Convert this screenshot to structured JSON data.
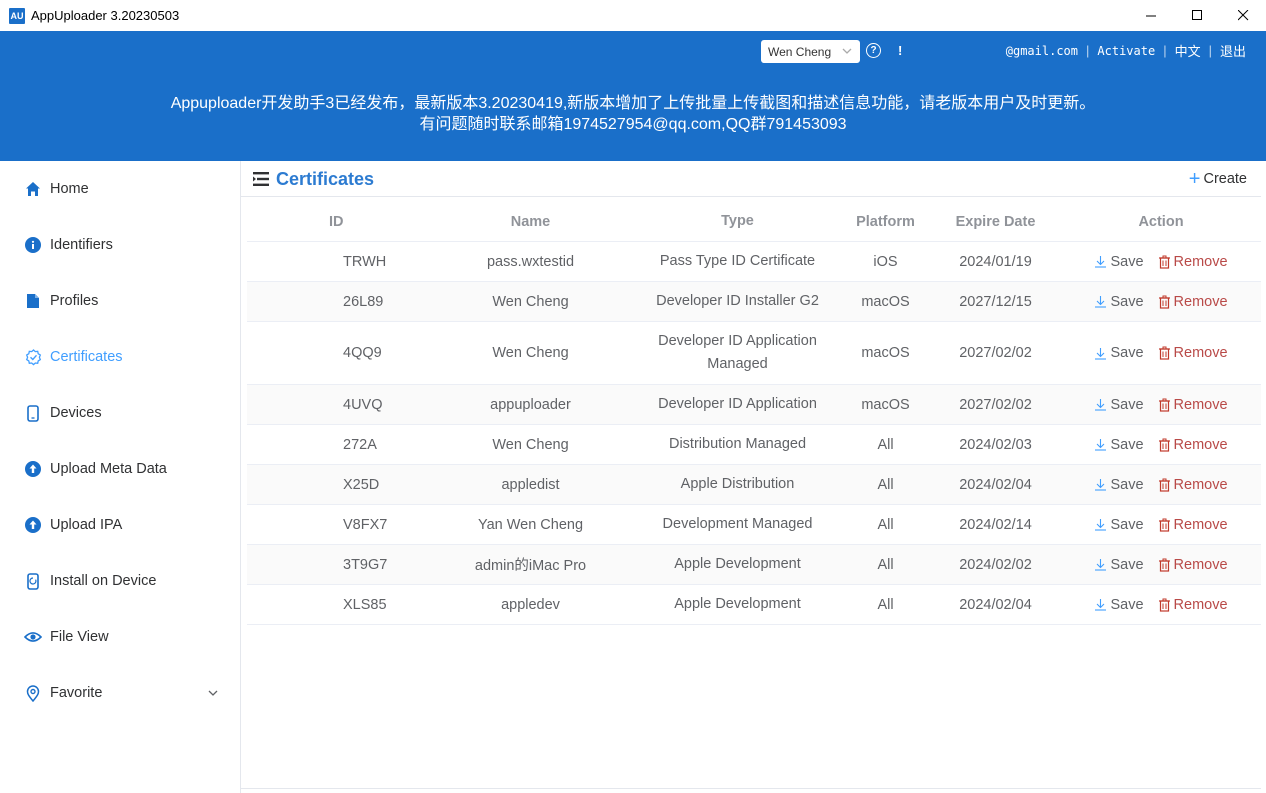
{
  "window": {
    "icon_text": "AU",
    "title": "AppUploader 3.20230503"
  },
  "header": {
    "account_selected": "Wen Cheng",
    "excl_mark": "!",
    "email": "@gmail.com",
    "activate": "Activate",
    "lang": "中文",
    "logout": "退出",
    "announcement_line1": "Appuploader开发助手3已经发布，最新版本3.20230419,新版本增加了上传批量上传截图和描述信息功能，请老版本用户及时更新。",
    "announcement_line2": "有问题随时联系邮箱1974527954@qq.com,QQ群791453093"
  },
  "sidebar": {
    "items": [
      {
        "label": "Home",
        "icon": "home-icon"
      },
      {
        "label": "Identifiers",
        "icon": "info-icon"
      },
      {
        "label": "Profiles",
        "icon": "profile-icon"
      },
      {
        "label": "Certificates",
        "icon": "certificate-icon",
        "active": true
      },
      {
        "label": "Devices",
        "icon": "phone-icon"
      },
      {
        "label": "Upload Meta Data",
        "icon": "upload-icon"
      },
      {
        "label": "Upload IPA",
        "icon": "upload-icon"
      },
      {
        "label": "Install on Device",
        "icon": "install-icon"
      },
      {
        "label": "File View",
        "icon": "eye-icon"
      },
      {
        "label": "Favorite",
        "icon": "location-icon"
      }
    ]
  },
  "page": {
    "title": "Certificates",
    "create_label": "Create"
  },
  "table": {
    "headers": {
      "id": "ID",
      "name": "Name",
      "type": "Type",
      "platform": "Platform",
      "expire": "Expire Date",
      "action": "Action"
    },
    "save_label": "Save",
    "remove_label": "Remove",
    "rows": [
      {
        "id": "TRWH",
        "name": "pass.wxtestid",
        "type": "Pass Type ID Certificate",
        "platform": "iOS",
        "expire": "2024/01/19"
      },
      {
        "id": "26L89",
        "name": "Wen Cheng",
        "type": "Developer ID Installer G2",
        "platform": "macOS",
        "expire": "2027/12/15"
      },
      {
        "id": "4QQ9",
        "name": "Wen Cheng",
        "type": "Developer ID Application Managed",
        "platform": "macOS",
        "expire": "2027/02/02"
      },
      {
        "id": "4UVQ",
        "name": "appuploader",
        "type": "Developer ID Application",
        "platform": "macOS",
        "expire": "2027/02/02"
      },
      {
        "id": "272A",
        "name": "Wen Cheng",
        "type": "Distribution Managed",
        "platform": "All",
        "expire": "2024/02/03"
      },
      {
        "id": "X25D",
        "name": "appledist",
        "type": "Apple Distribution",
        "platform": "All",
        "expire": "2024/02/04"
      },
      {
        "id": "V8FX7",
        "name": "Yan Wen Cheng",
        "type": "Development Managed",
        "platform": "All",
        "expire": "2024/02/14"
      },
      {
        "id": "3T9G7",
        "name": "admin的iMac Pro",
        "type": "Apple Development",
        "platform": "All",
        "expire": "2024/02/02"
      },
      {
        "id": "XLS85",
        "name": "appledev",
        "type": "Apple Development",
        "platform": "All",
        "expire": "2024/02/04"
      }
    ]
  },
  "colors": {
    "header_blue": "#1a6fc9",
    "active_blue": "#409eff",
    "remove_red": "#b94a48"
  }
}
